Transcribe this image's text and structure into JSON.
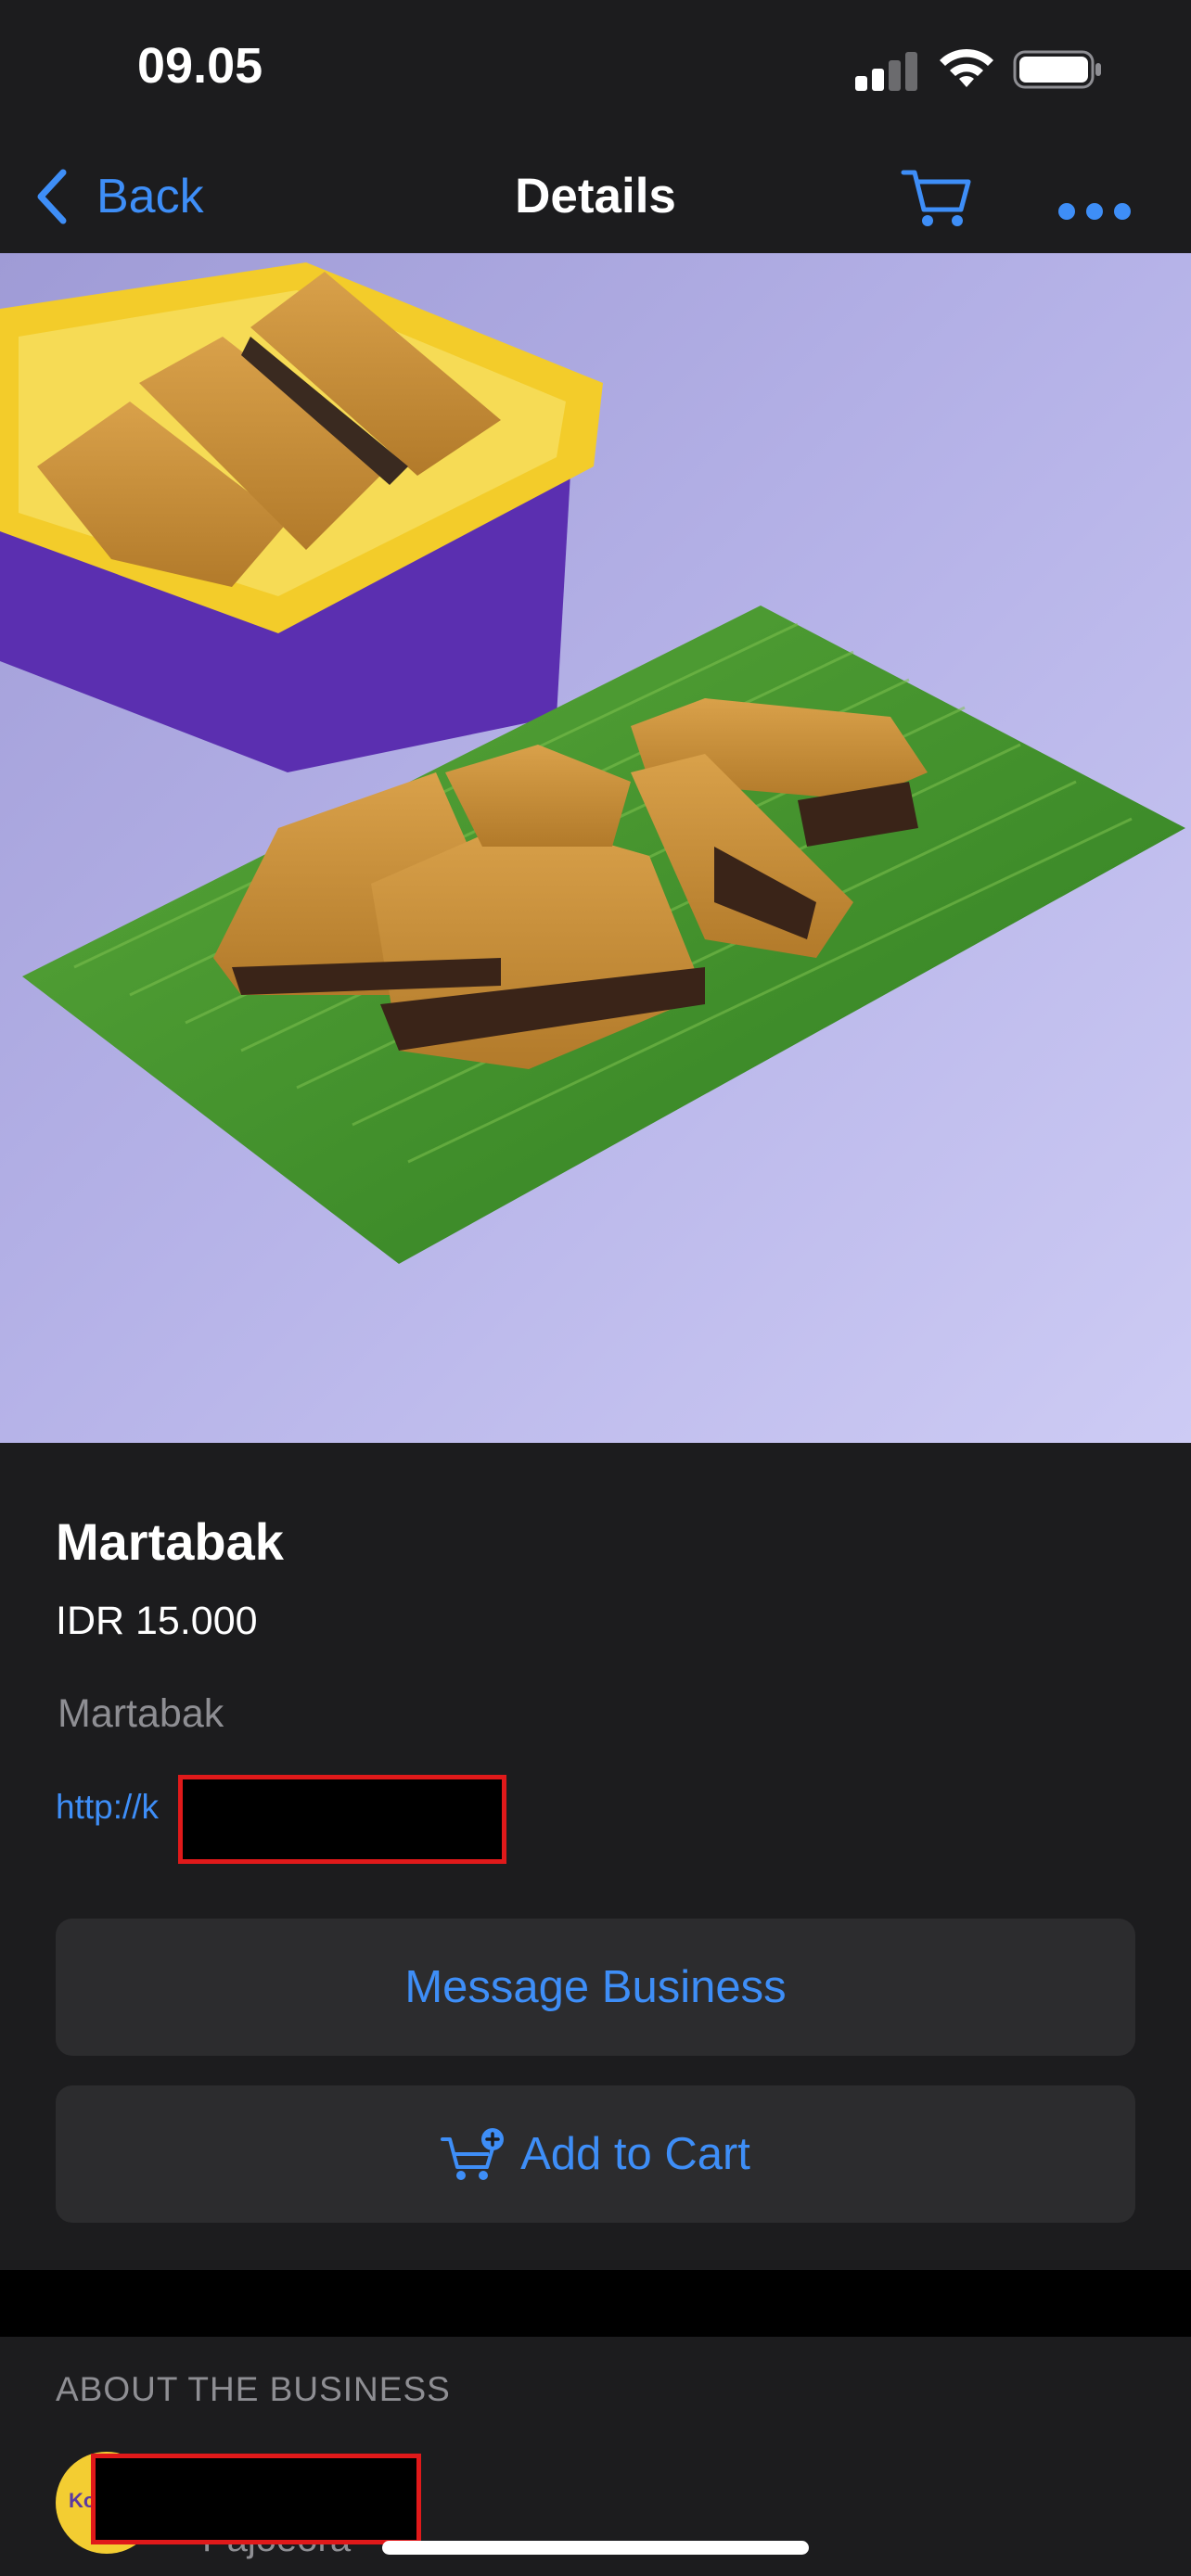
{
  "status_bar": {
    "time": "09.05"
  },
  "nav": {
    "back_label": "Back",
    "title": "Details",
    "icons": [
      "chevron-left-icon",
      "cart-icon",
      "ellipsis-icon"
    ]
  },
  "product": {
    "name": "Martabak",
    "price": "IDR 15.000",
    "description": "Martabak",
    "link_visible": "http://k"
  },
  "actions": {
    "message_label": "Message Business",
    "add_to_cart_label": "Add to Cart"
  },
  "about": {
    "header": "ABOUT THE BUSINESS",
    "avatar_text": "Ko",
    "subtitle_fragment": "Pajoeora"
  },
  "colors": {
    "accent": "#3e8ef7",
    "background": "#1c1c1e",
    "button": "#2c2c2e",
    "secondary_text": "#8e8e93",
    "redaction_border": "#e0191a"
  }
}
